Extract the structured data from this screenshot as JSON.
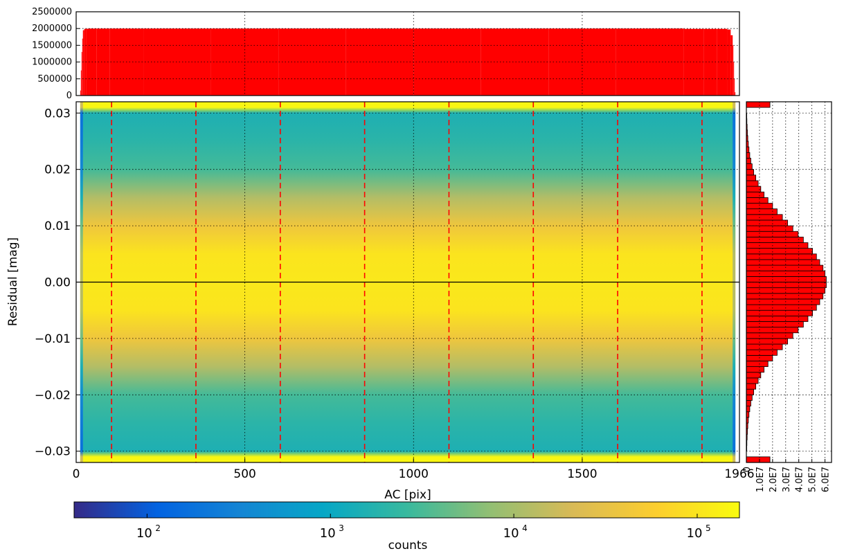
{
  "chart_data": [
    {
      "id": "top_histogram",
      "type": "bar",
      "title": "",
      "xlabel": "",
      "ylabel": "",
      "xlim": [
        0,
        1966
      ],
      "ylim": [
        0,
        2500000
      ],
      "yticks": [
        0,
        500000,
        1000000,
        1500000,
        2000000,
        2500000
      ],
      "ytick_labels": [
        "0",
        "500000",
        "1000000",
        "1500000",
        "2000000",
        "2500000"
      ],
      "grid": true,
      "bar_color": "#ff0000",
      "x": [
        12,
        14,
        16,
        18,
        20,
        24,
        30,
        40,
        60,
        100,
        200,
        400,
        600,
        800,
        1000,
        1200,
        1400,
        1600,
        1800,
        1860,
        1900,
        1930,
        1940,
        1946,
        1948,
        1950,
        1952,
        1954
      ],
      "values": [
        0,
        150000,
        750000,
        1300000,
        1700000,
        1950000,
        1990000,
        1995000,
        2000000,
        2000000,
        2000000,
        2000000,
        2000000,
        2000000,
        2000000,
        2000000,
        2000000,
        2000000,
        1990000,
        1960000,
        1990000,
        1970000,
        1800000,
        1500000,
        1000000,
        500000,
        100000,
        0
      ]
    },
    {
      "id": "main_heatmap",
      "type": "heatmap",
      "title": "",
      "xlabel": "AC [pix]",
      "ylabel": "Residual [mag]",
      "xlim": [
        0,
        1966
      ],
      "ylim": [
        -0.032,
        0.032
      ],
      "xticks": [
        0,
        500,
        1000,
        1500,
        1966
      ],
      "xtick_labels": [
        "0",
        "500",
        "1000",
        "1500",
        "1966"
      ],
      "yticks": [
        -0.03,
        -0.02,
        -0.01,
        0.0,
        0.01,
        0.02,
        0.03
      ],
      "ytick_labels": [
        "−0.03",
        "−0.02",
        "−0.01",
        "0.00",
        "0.01",
        "0.02",
        "0.03"
      ],
      "grid": true,
      "data_range_x": [
        12,
        1954
      ],
      "residual_profile": {
        "residual": [
          -0.031,
          -0.03,
          -0.025,
          -0.02,
          -0.015,
          -0.01,
          -0.005,
          0.0,
          0.005,
          0.01,
          0.015,
          0.02,
          0.025,
          0.03,
          0.031
        ],
        "counts": [
          150000,
          1500,
          2000,
          3000,
          12000,
          40000,
          100000,
          110000,
          100000,
          40000,
          12000,
          3000,
          2000,
          1500,
          150000
        ]
      },
      "vertical_lines": {
        "x": [
          105,
          355,
          605,
          855,
          1105,
          1355,
          1605,
          1855
        ],
        "color": "#ff0000",
        "style": "dashed"
      },
      "horizontal_line": {
        "y": 0.0,
        "color": "#000000"
      }
    },
    {
      "id": "right_histogram",
      "type": "bar",
      "orientation": "horizontal",
      "title": "",
      "xlabel": "",
      "ylabel": "",
      "xlim": [
        0,
        65000000
      ],
      "ylim": [
        -0.032,
        0.032
      ],
      "xticks": [
        0,
        10000000,
        20000000,
        30000000,
        40000000,
        50000000,
        60000000
      ],
      "xtick_labels": [
        "0",
        "1.0E7",
        "2.0E7",
        "3.0E7",
        "4.0E7",
        "5.0E7",
        "6.0E7"
      ],
      "grid": true,
      "bar_color": "#ff0000",
      "bin_width": 0.001,
      "bin_centers": [
        -0.0315,
        -0.0305,
        -0.0295,
        -0.0285,
        -0.0275,
        -0.0265,
        -0.0255,
        -0.0245,
        -0.0235,
        -0.0225,
        -0.0215,
        -0.0205,
        -0.0195,
        -0.0185,
        -0.0175,
        -0.0165,
        -0.0155,
        -0.0145,
        -0.0135,
        -0.0125,
        -0.0115,
        -0.0105,
        -0.0095,
        -0.0085,
        -0.0075,
        -0.0065,
        -0.0055,
        -0.0045,
        -0.0035,
        -0.0025,
        -0.0015,
        -0.0005,
        0.0005,
        0.0015,
        0.0025,
        0.0035,
        0.0045,
        0.0055,
        0.0065,
        0.0075,
        0.0085,
        0.0095,
        0.0105,
        0.0115,
        0.0125,
        0.0135,
        0.0145,
        0.0155,
        0.0165,
        0.0175,
        0.0185,
        0.0195,
        0.0205,
        0.0215,
        0.0225,
        0.0235,
        0.0245,
        0.0255,
        0.0265,
        0.0275,
        0.0285,
        0.0295,
        0.0305,
        0.0315
      ],
      "values": [
        18000000,
        0,
        300000,
        400000,
        600000,
        800000,
        1100000,
        1500000,
        2000000,
        2600000,
        3400000,
        4400000,
        5600000,
        7200000,
        9000000,
        11000000,
        13500000,
        16500000,
        20000000,
        23500000,
        27500000,
        31500000,
        35500000,
        39500000,
        43500000,
        47000000,
        50500000,
        53500000,
        56000000,
        58500000,
        60000000,
        61000000,
        61000000,
        60000000,
        58500000,
        56000000,
        53500000,
        50500000,
        47000000,
        43500000,
        39500000,
        35500000,
        31500000,
        27500000,
        23500000,
        20000000,
        16500000,
        13500000,
        11000000,
        9000000,
        7200000,
        5600000,
        4400000,
        3400000,
        2600000,
        2000000,
        1500000,
        1100000,
        800000,
        600000,
        400000,
        300000,
        0,
        18000000
      ]
    },
    {
      "id": "colorbar",
      "type": "colorbar",
      "title": "",
      "xlabel": "counts",
      "scale": "log",
      "range": [
        40,
        170000
      ],
      "ticks": [
        100,
        1000,
        10000,
        100000
      ],
      "tick_labels": [
        "10",
        "10",
        "10",
        "10"
      ],
      "tick_exponents": [
        "2",
        "3",
        "4",
        "5"
      ],
      "colormap": [
        "#352a87",
        "#0363e1",
        "#1485d4",
        "#06a7c6",
        "#38b99e",
        "#92bf73",
        "#d9ba56",
        "#fcce2e",
        "#f9fb0e"
      ]
    }
  ]
}
